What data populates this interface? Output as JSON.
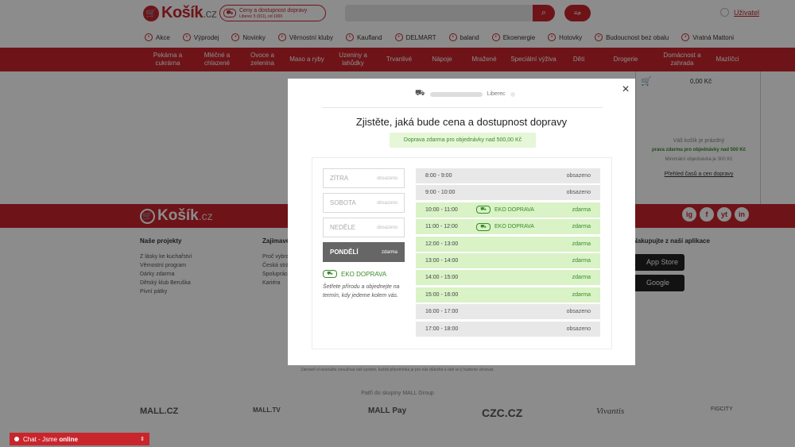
{
  "header": {
    "logo_main": "Košík",
    "logo_suffix": ".cz",
    "delivery_pill_line1": "Ceny a dostupnost dopravy",
    "delivery_pill_line2": "Liberec 5 (011), od 1000",
    "user_link": "Uživatel"
  },
  "nav2": [
    "Akce",
    "Výprodej",
    "Novinky",
    "Věrnostní kluby",
    "Kaufland",
    "DELMART",
    "baland",
    "Ekoenergie",
    "Hotovky",
    "Budoucnost bez obalu",
    "Vratná Mattoni"
  ],
  "categories": [
    {
      "label": "Pekárna a\ncukrárna"
    },
    {
      "label": "Mléčné a\nchlazené"
    },
    {
      "label": "Ovoce a\nzelenina"
    },
    {
      "label": "Maso a ryby"
    },
    {
      "label": "Uzeniny a\nlahůdky"
    },
    {
      "label": "Trvanlivé"
    },
    {
      "label": "Nápoje"
    },
    {
      "label": "Mražené"
    },
    {
      "label": "Speciální výživa"
    },
    {
      "label": "Děti"
    },
    {
      "label": "Drogerie"
    },
    {
      "label": "Domácnost a\nzahrada"
    },
    {
      "label": "Mazlíčci"
    }
  ],
  "cart_panel": {
    "price": "0,00 Kč",
    "empty": "Váš košík je prázdný",
    "free_note": "prava zdarma pro objednávky nad 500 Kč",
    "min_order": "Minimální objednávka je 300 Kč",
    "link": "Přehled časů a cen dopravy"
  },
  "footer": {
    "logo_main": "Košík",
    "logo_suffix": ".cz",
    "social": [
      "ig",
      "f",
      "yt",
      "in"
    ],
    "col1_title": "Naše projekty",
    "col1_items": [
      "Z lásky ke kuchařství",
      "Věrnostní program",
      "Dárky zdarma",
      "Dětský klub Beruška",
      "Pivní pátky"
    ],
    "col2_title": "Zajímavé",
    "col2_items": [
      "Proč vybrat",
      "Česká stránka",
      "Spolupráce",
      "Kariéra"
    ],
    "app_title": "Nakupujte z naší aplikace",
    "app_store": "App Store",
    "google_play": "Google Play",
    "note": "Zároveň si nesnažte zneužívat náš systém, každá připomínka je pro nás důležitá a rádi se jí budeme věnovat.",
    "group": "Patří do skupiny MALL Group",
    "brands": [
      "MALL.CZ",
      "MALL.TV",
      "MALL Pay",
      "CZC.CZ",
      "Vivantis",
      "FIGCITY"
    ]
  },
  "modal": {
    "close": "×",
    "address_city": "Liberec",
    "title": "Zjistěte, jaká bude cena a dostupnost dopravy",
    "free_shipping": "Doprava zdarma pro objednávky nad 500,00 Kč",
    "days": [
      {
        "name": "ZÍTRA",
        "status": "obsazeno",
        "active": false
      },
      {
        "name": "SOBOTA",
        "status": "obsazeno",
        "active": false
      },
      {
        "name": "NEDĚLE",
        "status": "obsazeno",
        "active": false
      },
      {
        "name": "PONDĚLÍ",
        "status": "zdarma",
        "active": true
      }
    ],
    "eko_label": "EKO DOPRAVA",
    "eko_text": "Šetřete přírodu a objednejte na termín, kdy jedeme kolem vás.",
    "slots": [
      {
        "time": "8:00 - 9:00",
        "eko": false,
        "status": "obsazeno",
        "free": false
      },
      {
        "time": "9:00 - 10:00",
        "eko": false,
        "status": "obsazeno",
        "free": false
      },
      {
        "time": "10:00 - 11:00",
        "eko": true,
        "status": "zdarma",
        "free": true
      },
      {
        "time": "11:00 - 12:00",
        "eko": true,
        "status": "zdarma",
        "free": true
      },
      {
        "time": "12:00 - 13:00",
        "eko": false,
        "status": "zdarma",
        "free": true
      },
      {
        "time": "13:00 - 14:00",
        "eko": false,
        "status": "zdarma",
        "free": true
      },
      {
        "time": "14:00 - 15:00",
        "eko": false,
        "status": "zdarma",
        "free": true
      },
      {
        "time": "15:00 - 16:00",
        "eko": false,
        "status": "zdarma",
        "free": true
      },
      {
        "time": "16:00 - 17:00",
        "eko": false,
        "status": "obsazeno",
        "free": false
      },
      {
        "time": "17:00 - 18:00",
        "eko": false,
        "status": "obsazeno",
        "free": false
      }
    ]
  },
  "chat": {
    "prefix": "Chat - Jsme ",
    "status": "online"
  }
}
